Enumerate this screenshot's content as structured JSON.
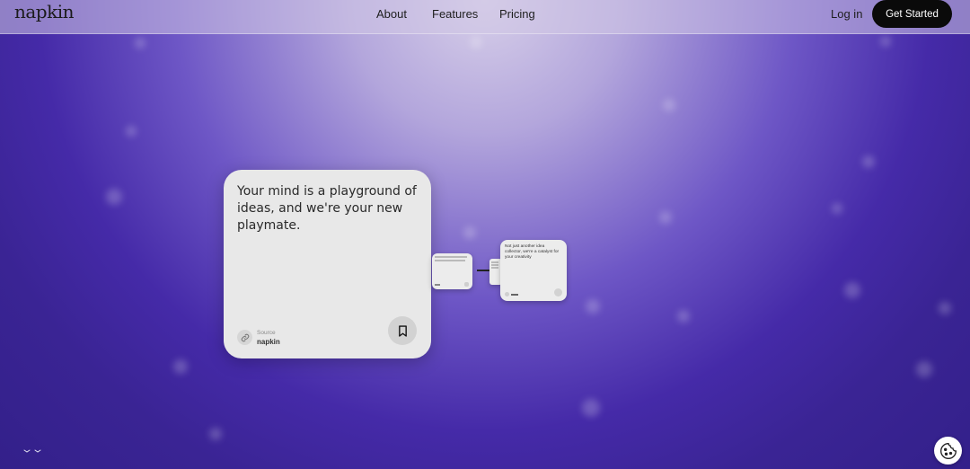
{
  "header": {
    "logo": "napkin",
    "nav": [
      "About",
      "Features",
      "Pricing"
    ],
    "login": "Log in",
    "cta": "Get Started"
  },
  "main_card": {
    "text": "Your mind is a playground of ideas, and we're your new playmate.",
    "source_label": "Source",
    "source_name": "napkin"
  },
  "mini_cards": [
    {
      "text": "Not just another idea collector, we're a catalyst for your creativity"
    }
  ],
  "icons": [
    "link-icon",
    "bookmark-icon",
    "cookie-icon",
    "chevron-down-icon"
  ],
  "colors": {
    "cta_bg": "#0a0a0a",
    "bg_deep": "#3a2494",
    "card_bg": "#e8e8e8"
  }
}
